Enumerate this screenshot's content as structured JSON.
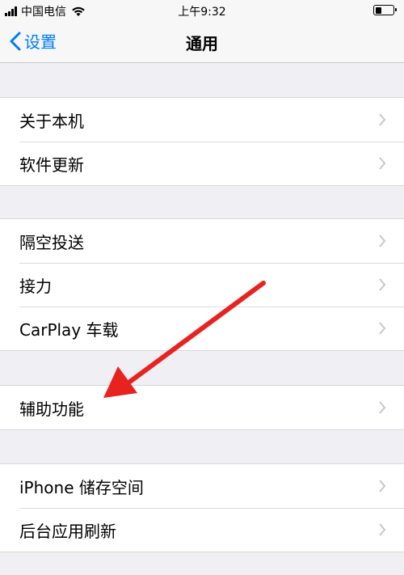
{
  "status_bar": {
    "carrier": "中国电信",
    "time": "上午9:32",
    "battery_level": 0.35
  },
  "nav": {
    "back_label": "设置",
    "title": "通用"
  },
  "groups": [
    {
      "items": [
        {
          "label": "关于本机"
        },
        {
          "label": "软件更新"
        }
      ]
    },
    {
      "items": [
        {
          "label": "隔空投送"
        },
        {
          "label": "接力"
        },
        {
          "label": "CarPlay 车载"
        }
      ]
    },
    {
      "items": [
        {
          "label": "辅助功能"
        }
      ]
    },
    {
      "items": [
        {
          "label": "iPhone 储存空间"
        },
        {
          "label": "后台应用刷新"
        }
      ]
    }
  ],
  "colors": {
    "accent": "#007aff",
    "annotation": "#e8231f",
    "background": "#efeff4"
  },
  "icons": [
    "signal-bars-icon",
    "wifi-icon",
    "battery-icon",
    "back-chevron-icon",
    "chevron-right-icon",
    "red-arrow-annotation"
  ]
}
